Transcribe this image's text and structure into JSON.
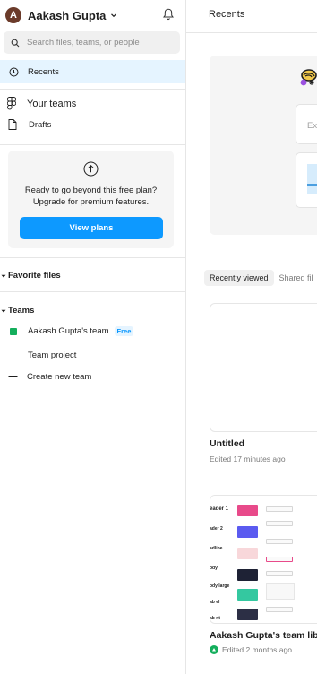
{
  "user": {
    "initial": "A",
    "name": "Aakash Gupta"
  },
  "search": {
    "placeholder": "Search files, teams, or people",
    "value": ""
  },
  "sidebar": {
    "recents_label": "Recents",
    "your_teams_label": "Your teams",
    "drafts_label": "Drafts",
    "upgrade": {
      "line1": "Ready to go beyond this free plan?",
      "line2": "Upgrade for premium features.",
      "button_label": "View plans"
    },
    "favorite_files_label": "Favorite files",
    "teams_label": "Teams",
    "team": {
      "name": "Aakash Gupta's team",
      "badge": "Free"
    },
    "team_project_label": "Team project",
    "create_team_label": "Create new team"
  },
  "main": {
    "title": "Recents",
    "banner": {
      "card_text": "Ex"
    },
    "tabs": [
      {
        "label": "Recently viewed",
        "active": true
      },
      {
        "label": "Shared fil",
        "active": false
      }
    ],
    "files": [
      {
        "name": "Untitled",
        "meta": "Edited 17 minutes ago"
      },
      {
        "name": "Aakash Gupta's team lib",
        "meta": "Edited 2 months ago"
      }
    ],
    "library_thumb": {
      "labels": [
        "eader 1",
        "ader 2",
        "adline",
        "ody",
        "ody large",
        "ab el",
        "ab nt"
      ]
    }
  },
  "colors": {
    "accent": "#0d99ff",
    "selected_bg": "#e5f4ff",
    "team_green": "#14ae5c",
    "avatar_brown": "#6b3b2a"
  }
}
